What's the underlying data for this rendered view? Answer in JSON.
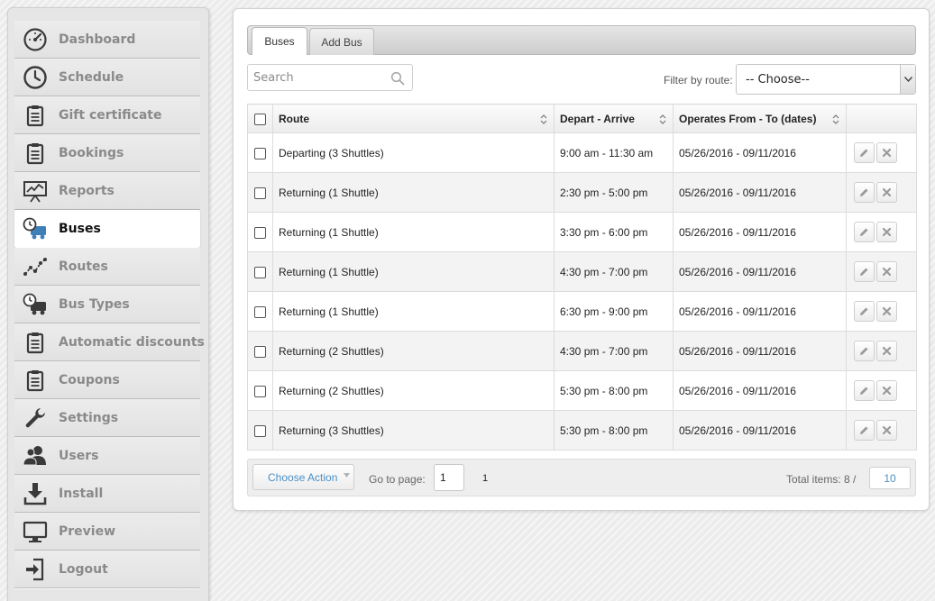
{
  "sidebar": {
    "items": [
      {
        "label": "Dashboard",
        "icon": "speedometer-icon",
        "active": false
      },
      {
        "label": "Schedule",
        "icon": "clock-icon",
        "active": false
      },
      {
        "label": "Gift certificate",
        "icon": "clipboard-icon",
        "active": false
      },
      {
        "label": "Bookings",
        "icon": "clipboard-icon",
        "active": false
      },
      {
        "label": "Reports",
        "icon": "chart-board-icon",
        "active": false
      },
      {
        "label": "Buses",
        "icon": "bus-clock-icon",
        "active": true
      },
      {
        "label": "Routes",
        "icon": "route-line-icon",
        "active": false
      },
      {
        "label": "Bus Types",
        "icon": "bus-clock-icon",
        "active": false
      },
      {
        "label": "Automatic discounts",
        "icon": "clipboard-icon",
        "active": false
      },
      {
        "label": "Coupons",
        "icon": "clipboard-icon",
        "active": false
      },
      {
        "label": "Settings",
        "icon": "wrench-icon",
        "active": false
      },
      {
        "label": "Users",
        "icon": "users-icon",
        "active": false
      },
      {
        "label": "Install",
        "icon": "download-icon",
        "active": false
      },
      {
        "label": "Preview",
        "icon": "monitor-icon",
        "active": false
      },
      {
        "label": "Logout",
        "icon": "logout-icon",
        "active": false
      }
    ]
  },
  "tabs": {
    "buses": "Buses",
    "add_bus": "Add Bus"
  },
  "search": {
    "placeholder": "Search",
    "value": ""
  },
  "filter": {
    "label": "Filter by route:",
    "selected": "-- Choose--"
  },
  "table": {
    "columns": {
      "route": "Route",
      "depart_arrive": "Depart - Arrive",
      "operates": "Operates From - To (dates)"
    },
    "rows": [
      {
        "route": "Departing (3 Shuttles)",
        "time": "9:00 am - 11:30 am",
        "dates": "05/26/2016 - 09/11/2016"
      },
      {
        "route": "Returning (1 Shuttle)",
        "time": "2:30 pm - 5:00 pm",
        "dates": "05/26/2016 - 09/11/2016"
      },
      {
        "route": "Returning (1 Shuttle)",
        "time": "3:30 pm - 6:00 pm",
        "dates": "05/26/2016 - 09/11/2016"
      },
      {
        "route": "Returning (1 Shuttle)",
        "time": "4:30 pm - 7:00 pm",
        "dates": "05/26/2016 - 09/11/2016"
      },
      {
        "route": "Returning (1 Shuttle)",
        "time": "6:30 pm - 9:00 pm",
        "dates": "05/26/2016 - 09/11/2016"
      },
      {
        "route": "Returning (2 Shuttles)",
        "time": "4:30 pm - 7:00 pm",
        "dates": "05/26/2016 - 09/11/2016"
      },
      {
        "route": "Returning (2 Shuttles)",
        "time": "5:30 pm - 8:00 pm",
        "dates": "05/26/2016 - 09/11/2016"
      },
      {
        "route": "Returning (3 Shuttles)",
        "time": "5:30 pm - 8:00 pm",
        "dates": "05/26/2016 - 09/11/2016"
      }
    ]
  },
  "pager": {
    "choose_action": "Choose Action",
    "goto_label": "Go to page:",
    "goto_value": "1",
    "current_page": "1",
    "total_label": "Total items: 8 /",
    "per_page": "10"
  },
  "colors": {
    "link_blue": "#4a8fc4",
    "icon_dark": "#3a3a3a",
    "active_bus_blue": "#3f7fb8"
  }
}
